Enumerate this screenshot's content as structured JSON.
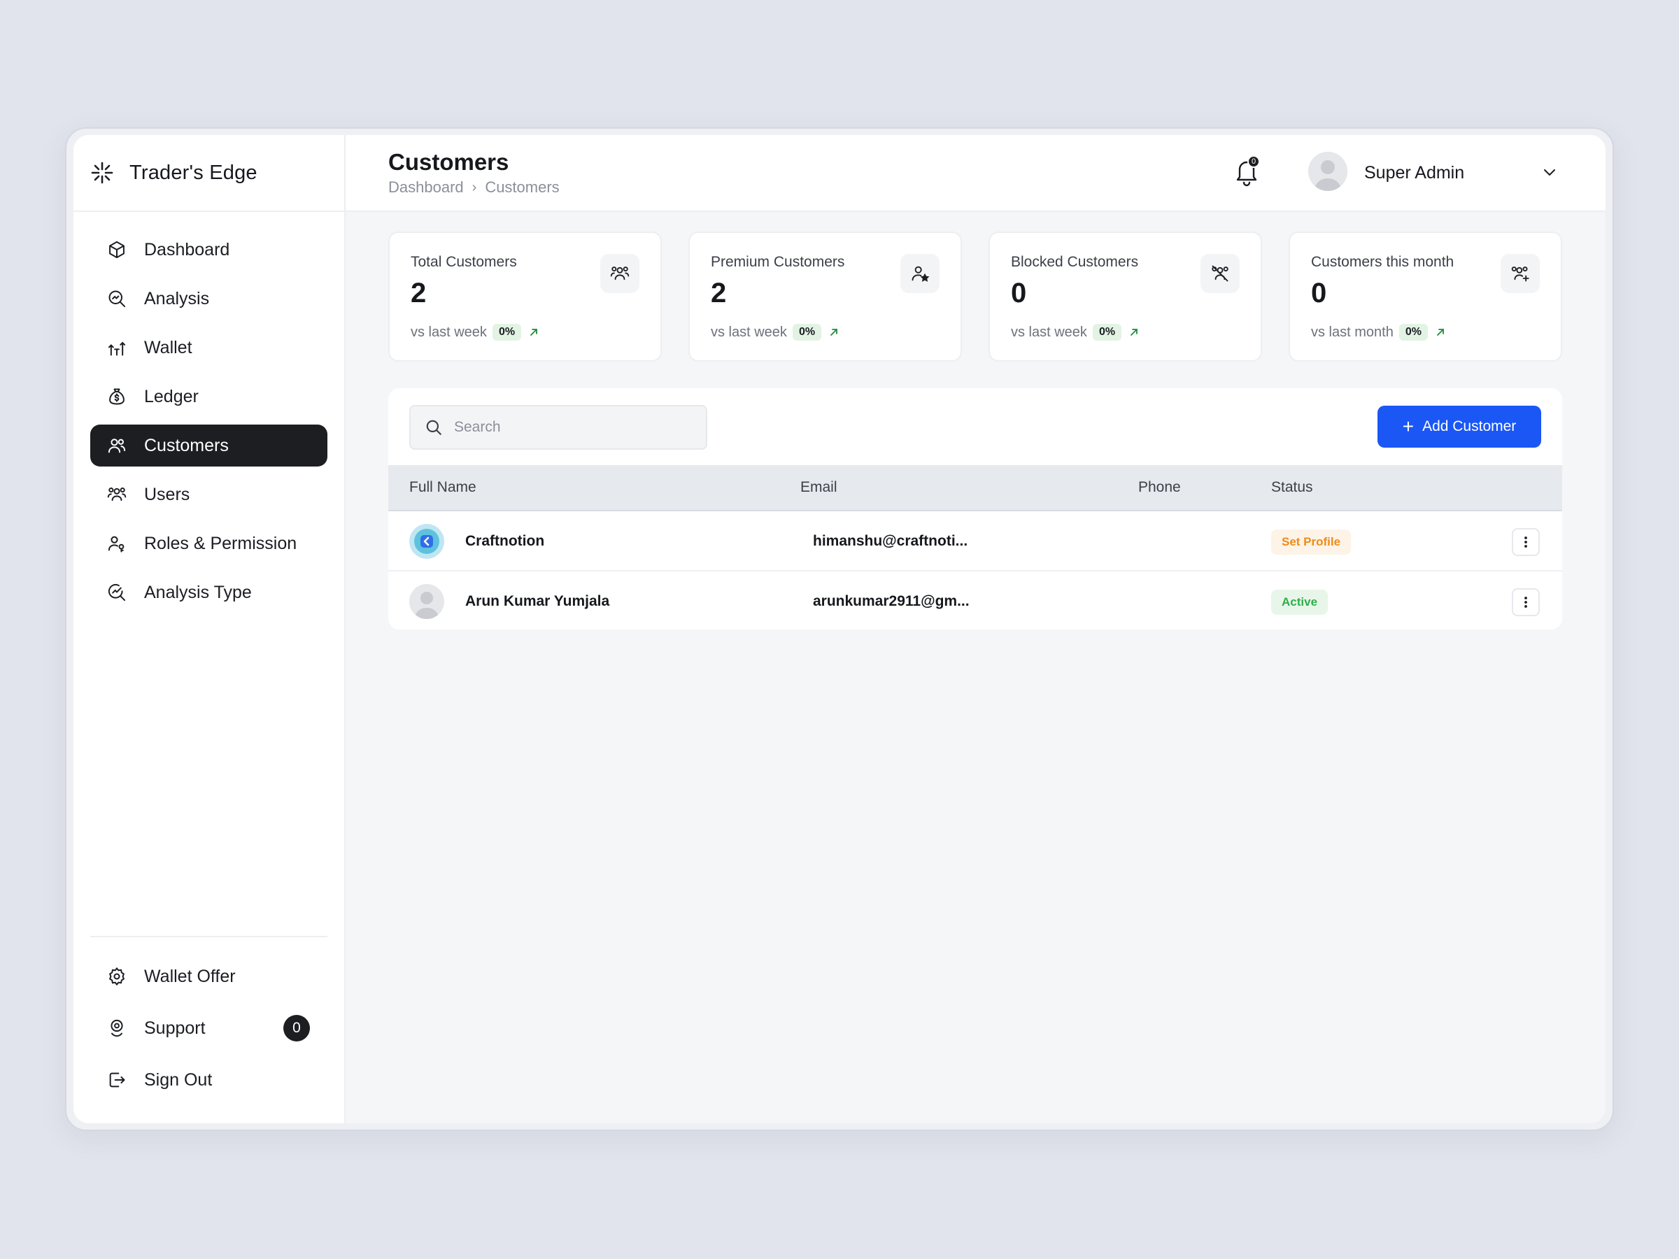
{
  "app": {
    "brand": "Trader's Edge"
  },
  "sidebar": {
    "items": [
      {
        "label": "Dashboard",
        "icon": "cube-icon"
      },
      {
        "label": "Analysis",
        "icon": "analysis-icon"
      },
      {
        "label": "Wallet",
        "icon": "wallet-icon"
      },
      {
        "label": "Ledger",
        "icon": "money-bag-icon"
      },
      {
        "label": "Customers",
        "icon": "customers-icon",
        "active": true
      },
      {
        "label": "Users",
        "icon": "users-icon"
      },
      {
        "label": "Roles & Permission",
        "icon": "user-key-icon"
      },
      {
        "label": "Analysis Type",
        "icon": "analysis-type-icon"
      }
    ],
    "bottom": {
      "wallet_offer": "Wallet Offer",
      "support": "Support",
      "support_count": "0",
      "sign_out": "Sign Out"
    }
  },
  "header": {
    "title": "Customers",
    "breadcrumb": [
      "Dashboard",
      "Customers"
    ],
    "notification_count": "0",
    "user_name": "Super Admin"
  },
  "stats": [
    {
      "label": "Total Customers",
      "value": "2",
      "compare": "vs last week",
      "change": "0%",
      "icon": "users-group-icon"
    },
    {
      "label": "Premium Customers",
      "value": "2",
      "compare": "vs last week",
      "change": "0%",
      "icon": "user-star-icon"
    },
    {
      "label": "Blocked Customers",
      "value": "0",
      "compare": "vs last week",
      "change": "0%",
      "icon": "users-blocked-icon"
    },
    {
      "label": "Customers this month",
      "value": "0",
      "compare": "vs last month",
      "change": "0%",
      "icon": "users-add-icon"
    }
  ],
  "table": {
    "search_placeholder": "Search",
    "add_button": "Add Customer",
    "columns": [
      "Full Name",
      "Email",
      "Phone",
      "Status"
    ],
    "rows": [
      {
        "name": "Craftnotion",
        "email": "himanshu@craftnoti...",
        "phone": "",
        "status": "Set Profile",
        "status_color": "#ee8c1a"
      },
      {
        "name": "Arun Kumar Yumjala",
        "email": "arunkumar2911@gm...",
        "phone": "",
        "status": "Active",
        "status_color": "#2eae4a"
      }
    ]
  },
  "colors": {
    "accent": "#1b57f5",
    "active_nav": "#1d1e22",
    "positive": "#2eae4a",
    "warning": "#ee8c1a"
  }
}
